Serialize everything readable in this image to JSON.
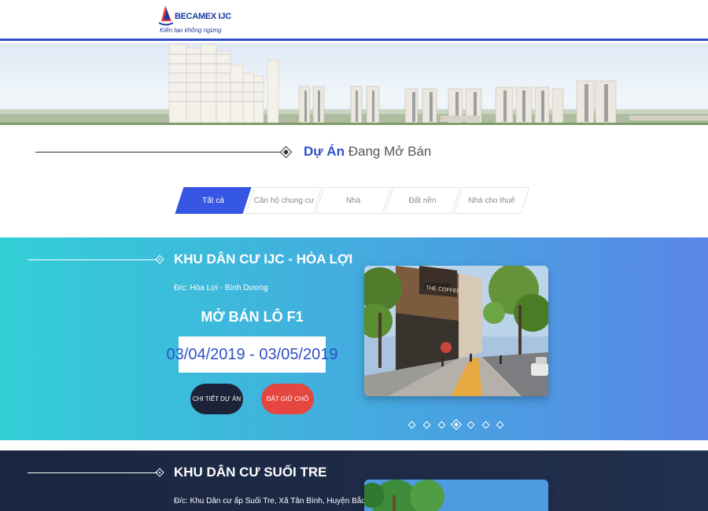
{
  "header": {
    "logo_name": "BECAMEX IJC",
    "logo_tagline": "Kiến tạo không ngừng"
  },
  "section": {
    "title_strong": "Dự Án",
    "title_rest": "Đang Mở Bán"
  },
  "tabs": [
    {
      "label": "Tất cả",
      "active": true
    },
    {
      "label": "Căn hộ chung cư",
      "active": false
    },
    {
      "label": "Nhà",
      "active": false
    },
    {
      "label": "Đất nền",
      "active": false
    },
    {
      "label": "Nhà cho thuê",
      "active": false
    }
  ],
  "projects": [
    {
      "title": "KHU DÂN CƯ IJC - HÒA LỢI",
      "address": "Đ/c: Hòa Lợi - Bình Dương",
      "sale_label": "MỞ BÁN LÔ F1",
      "sale_dates": "03/04/2019 - 03/05/2019",
      "detail_button": "CHI TIẾT DỰ ÁN",
      "book_button": "ĐẶT GIỮ CHỖ",
      "image_sign": "THE COFFEE"
    },
    {
      "title": "KHU DÂN CƯ SUỐI TRE",
      "address": "Đ/c: Khu Dân cư ấp Suối Tre, Xã Tân Bình, Huyện Bắc Tân Uyên"
    }
  ],
  "carousel": {
    "slide_count": 7,
    "active_index": 3
  },
  "colors": {
    "brand_blue": "#2f4fc9",
    "tab_active": "#3557e3",
    "panel1_start": "#33cfd6",
    "panel1_end": "#5a86e6",
    "panel2": "#1a2540",
    "detail_button": "#1c2237",
    "book_button": "#e5463f"
  }
}
